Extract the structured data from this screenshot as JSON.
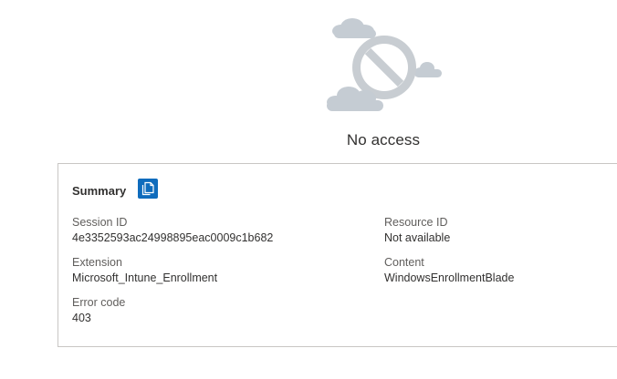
{
  "page": {
    "title": "No access"
  },
  "summary": {
    "heading": "Summary",
    "copy_icon": "copy-icon",
    "fields": {
      "session_id": {
        "label": "Session ID",
        "value": "4e3352593ac24998895eac0009c1b682"
      },
      "resource_id": {
        "label": "Resource ID",
        "value": "Not available"
      },
      "extension": {
        "label": "Extension",
        "value": "Microsoft_Intune_Enrollment"
      },
      "content": {
        "label": "Content",
        "value": "WindowsEnrollmentBlade"
      },
      "error_code": {
        "label": "Error code",
        "value": "403"
      }
    }
  },
  "colors": {
    "accent": "#0f6cbd",
    "illustration": "#c8cdd2",
    "border": "#c8c6c4"
  }
}
